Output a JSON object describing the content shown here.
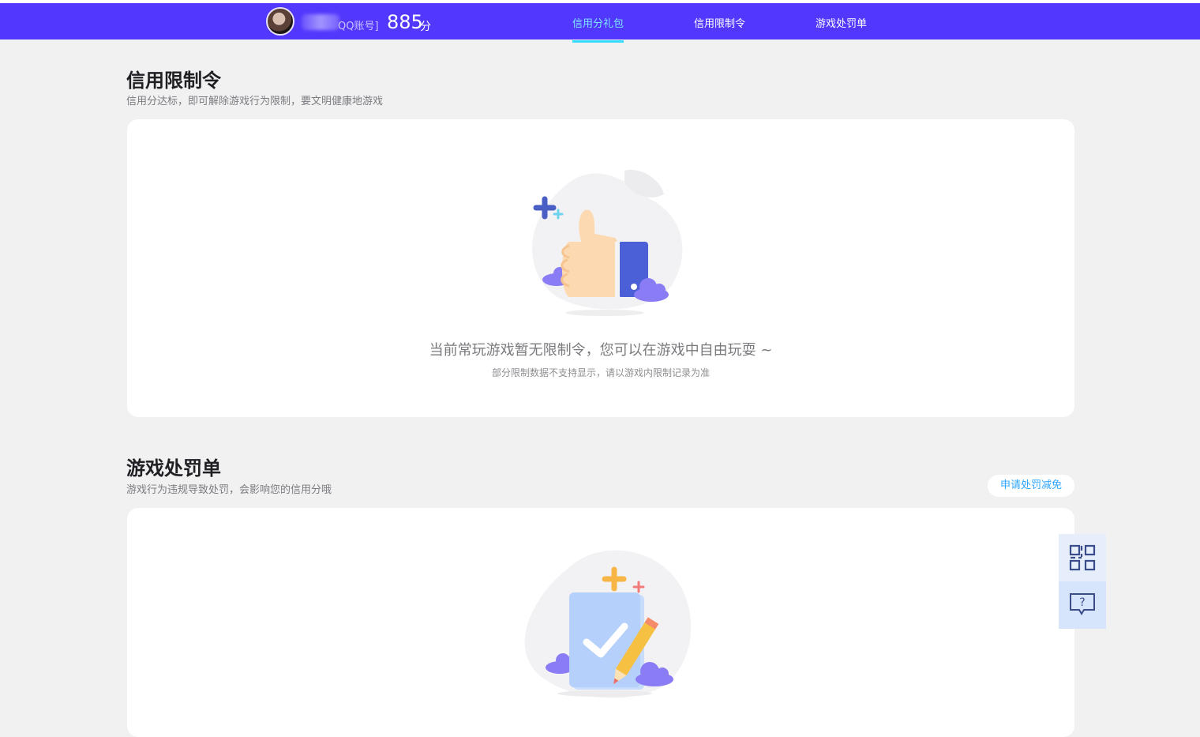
{
  "header": {
    "account_suffix": "QQ账号]",
    "score": "885",
    "score_unit": "分",
    "tabs": [
      {
        "label": "信用分礼包",
        "active": true
      },
      {
        "label": "信用限制令",
        "active": false
      },
      {
        "label": "游戏处罚单",
        "active": false
      }
    ]
  },
  "restriction": {
    "title": "信用限制令",
    "subtitle": "信用分达标，即可解除游戏行为限制，要文明健康地游戏",
    "empty_main": "当前常玩游戏暂无限制令，您可以在游戏中自由玩耍 ~",
    "empty_sub": "部分限制数据不支持显示，请以游戏内限制记录为准",
    "illustration": "thumbs-up-icon"
  },
  "penalty": {
    "title": "游戏处罚单",
    "subtitle": "游戏行为违规导致处罚，会影响您的信用分哦",
    "apply_button": "申请处罚减免",
    "illustration": "document-check-icon"
  },
  "side_tools": [
    {
      "icon": "qr-code-icon"
    },
    {
      "icon": "help-chat-icon"
    }
  ],
  "colors": {
    "header_bg": "#5238fd",
    "active_tab": "#7ee7ff",
    "page_bg": "#f1f1f2",
    "accent_blue": "#2ea6ff"
  }
}
